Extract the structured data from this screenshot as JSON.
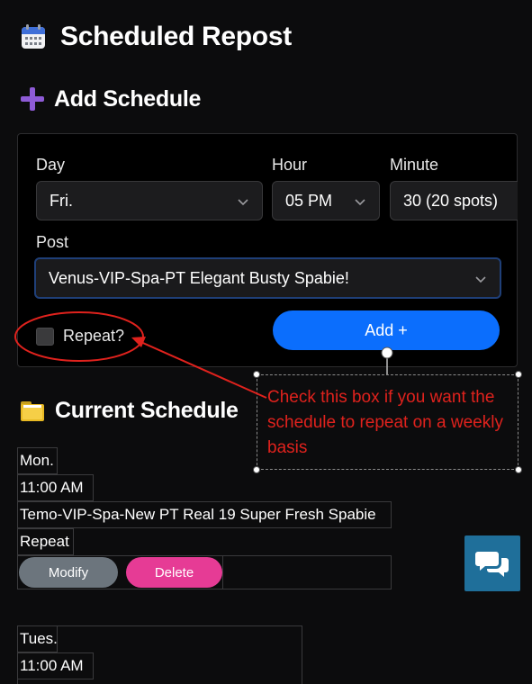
{
  "header": {
    "title": "Scheduled Repost",
    "title_icon": "calendar-icon"
  },
  "add_section": {
    "title": "Add Schedule",
    "icon": "plus-icon",
    "day": {
      "label": "Day",
      "value": "Fri."
    },
    "hour": {
      "label": "Hour",
      "value": "05 PM"
    },
    "minute": {
      "label": "Minute",
      "value": "30 (20 spots)"
    },
    "post": {
      "label": "Post",
      "value": "Venus-VIP-Spa-PT Elegant Busty Spabie!"
    },
    "repeat": {
      "label": "Repeat?",
      "checked": false
    },
    "add_button": "Add +"
  },
  "current_section": {
    "title": "Current Schedule",
    "icon": "folder-icon",
    "entries": [
      {
        "day": "Mon.",
        "time": "11:00 AM",
        "post": "Temo-VIP-Spa-New PT Real 19 Super Fresh Spabie",
        "repeat": "Repeat",
        "modify": "Modify",
        "delete": "Delete"
      },
      {
        "day": "Tues.",
        "time": "11:00 AM"
      }
    ]
  },
  "annotation": {
    "text": "Check this box if you want the schedule to repeat on a weekly basis",
    "color": "#e0221d"
  },
  "chat_button": {
    "icon": "chat-icon",
    "color": "#1f6f9a"
  },
  "colors": {
    "accent_blue": "#0b6efd",
    "delete_pink": "#e63b95",
    "modify_gray": "#6c757d",
    "background": "#0c0c0d"
  }
}
